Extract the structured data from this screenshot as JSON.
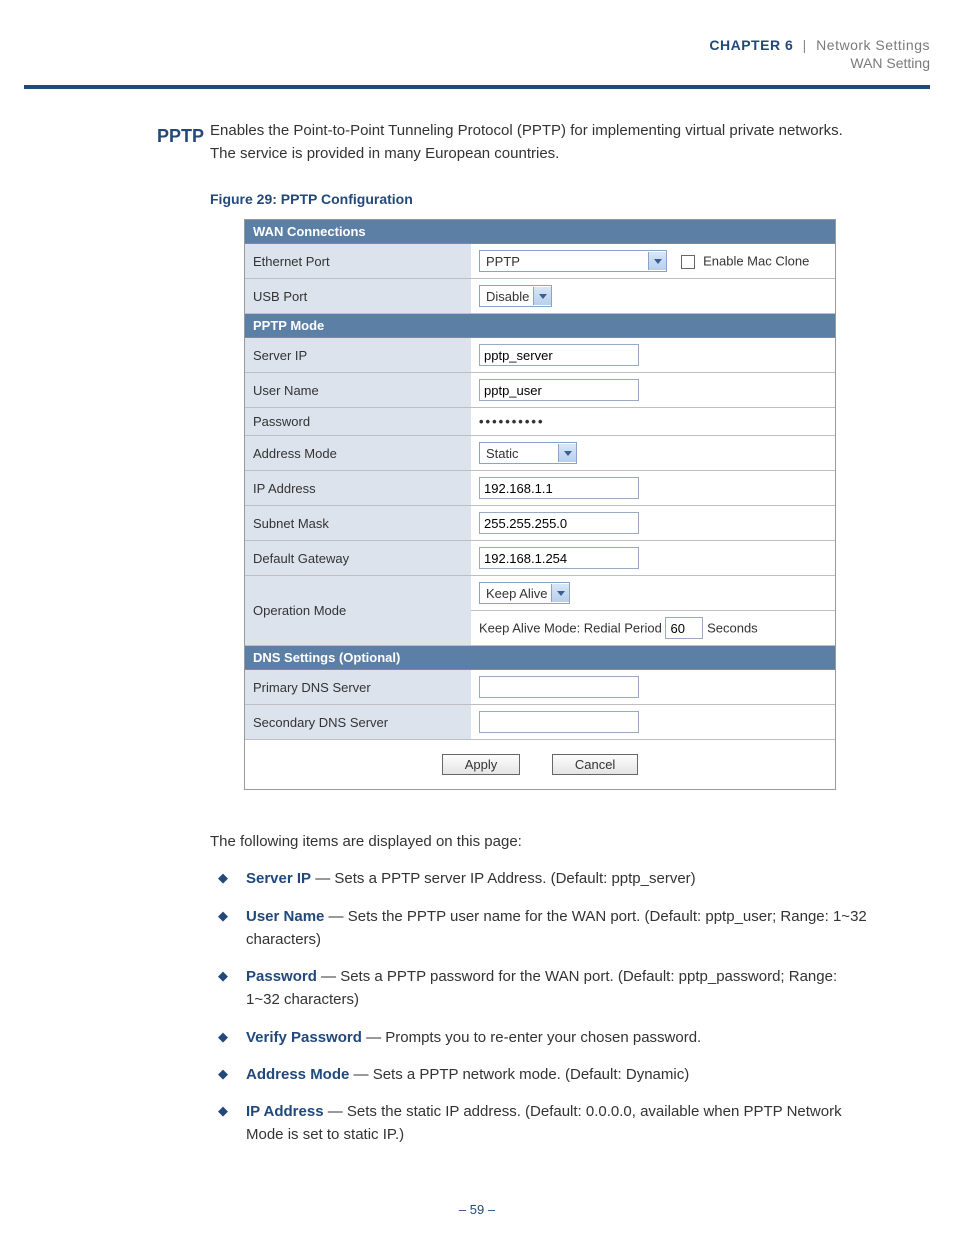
{
  "header": {
    "chapter_word": "CHAPTER",
    "chapter_num": "6",
    "divider": "|",
    "section": "Network Settings",
    "subsection": "WAN Setting"
  },
  "pptp": {
    "side_label": "PPTP",
    "intro": "Enables the Point-to-Point Tunneling Protocol (PPTP) for implementing virtual private networks. The service is provided in many European countries.",
    "figure_label": "Figure 29:  PPTP Configuration"
  },
  "panel": {
    "sec_wan": "WAN Connections",
    "ethernet_label": "Ethernet Port",
    "ethernet_select": "PPTP",
    "enable_mac_label": "Enable Mac Clone",
    "usb_label": "USB Port",
    "usb_select": "Disable",
    "sec_mode": "PPTP Mode",
    "server_ip_label": "Server IP",
    "server_ip_value": "pptp_server",
    "user_label": "User Name",
    "user_value": "pptp_user",
    "pwd_label": "Password",
    "pwd_value": "••••••••••",
    "addr_mode_label": "Address Mode",
    "addr_mode_value": "Static",
    "ip_label": "IP Address",
    "ip_value": "192.168.1.1",
    "subnet_label": "Subnet Mask",
    "subnet_value": "255.255.255.0",
    "gw_label": "Default Gateway",
    "gw_value": "192.168.1.254",
    "op_mode_label": "Operation Mode",
    "op_mode_value": "Keep Alive",
    "redial_prefix": "Keep Alive Mode: Redial Period",
    "redial_value": "60",
    "redial_suffix": "Seconds",
    "sec_dns": "DNS Settings (Optional)",
    "dns1_label": "Primary DNS Server",
    "dns2_label": "Secondary DNS Server",
    "apply": "Apply",
    "cancel": "Cancel"
  },
  "after": {
    "lead": "The following items are displayed on this page:",
    "items": [
      {
        "term": "Server IP",
        "desc": " — Sets a PPTP server IP Address. (Default: pptp_server)"
      },
      {
        "term": "User Name",
        "desc": " — Sets the PPTP user name for the WAN port. (Default: pptp_user; Range: 1~32 characters)"
      },
      {
        "term": "Password",
        "desc": " — Sets a PPTP password for the WAN port. (Default: pptp_password; Range: 1~32 characters)"
      },
      {
        "term": "Verify Password",
        "desc": " — Prompts you to re-enter your chosen password."
      },
      {
        "term": "Address Mode",
        "desc": " — Sets a PPTP network mode. (Default: Dynamic)"
      },
      {
        "term": "IP Address",
        "desc": " — Sets the static IP address. (Default: 0.0.0.0, available when PPTP Network Mode is set to static IP.)"
      }
    ]
  },
  "footer": {
    "page": "–  59  –"
  }
}
